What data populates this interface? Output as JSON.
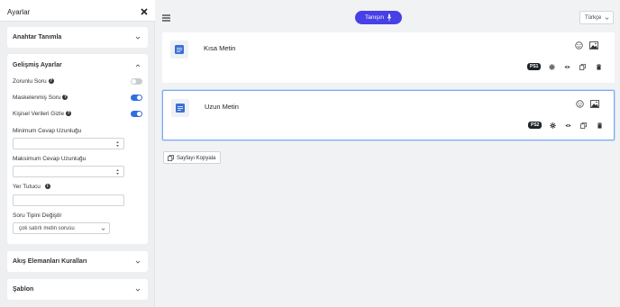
{
  "sidebar": {
    "title": "Ayarlar",
    "sections": {
      "key": "Anahtar Tanımla",
      "advanced": "Gelişmiş Ayarlar",
      "flow": "Akış Elemanları Kuralları",
      "template": "Şablon"
    },
    "options": [
      {
        "label": "Zorunlu Soru",
        "on": false
      },
      {
        "label": "Maskelenmiş Soru",
        "on": true
      },
      {
        "label": "Kişisel Verileri Gizle",
        "on": true
      }
    ],
    "fields": {
      "min_label": "Minimum Cevap Uzunluğu",
      "max_label": "Maksimum Cevap Uzunluğu",
      "placeholder_label": "Yer Tutucu",
      "type_label": "Soru Tipini Değiştir",
      "type_value": "çok satırlı metin sorusu"
    }
  },
  "header": {
    "tanism_label": "Tanışın",
    "language": "Türkçe"
  },
  "questions": [
    {
      "title": "Kısa Metin",
      "badge": "PS1"
    },
    {
      "title": "Uzun Metin",
      "badge": "PS2"
    }
  ],
  "copy_page_label": "Sayfayı Kopyala",
  "colors": {
    "accent": "#4640e6",
    "toggle_on": "#2f6de1",
    "selected_border": "#7aa7ee"
  }
}
